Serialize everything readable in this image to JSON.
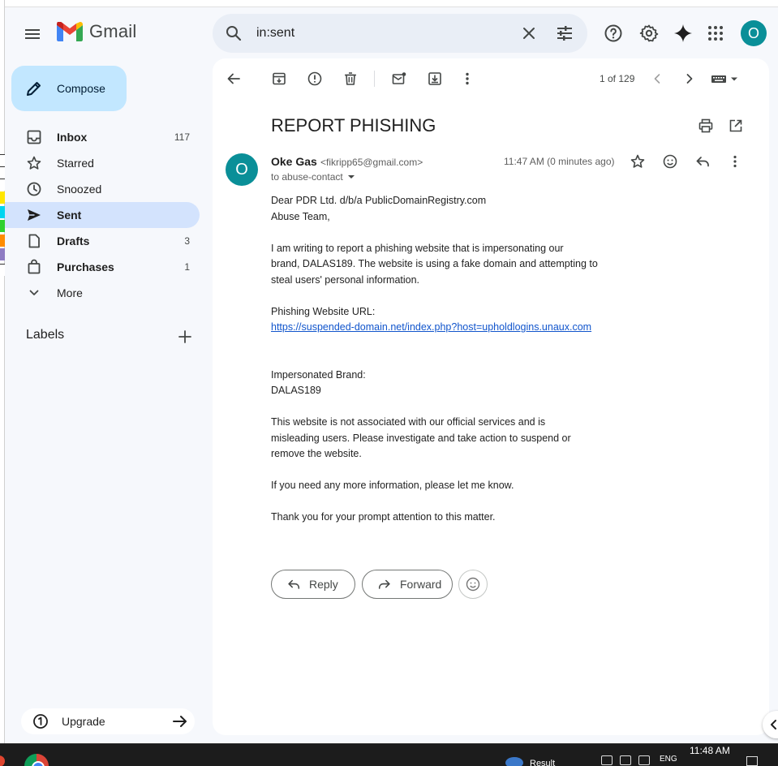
{
  "app": {
    "name": "Gmail",
    "avatar_letter": "O"
  },
  "search": {
    "value": "in:sent"
  },
  "compose": {
    "label": "Compose"
  },
  "nav": [
    {
      "label": "Inbox",
      "count": "117",
      "icon": "inbox-icon",
      "bold": true
    },
    {
      "label": "Starred",
      "count": "",
      "icon": "star-icon",
      "bold": false
    },
    {
      "label": "Snoozed",
      "count": "",
      "icon": "clock-icon",
      "bold": false
    },
    {
      "label": "Sent",
      "count": "",
      "icon": "send-icon",
      "bold": true,
      "active": true
    },
    {
      "label": "Drafts",
      "count": "3",
      "icon": "draft-icon",
      "bold": true
    },
    {
      "label": "Purchases",
      "count": "1",
      "icon": "shopping-bag-icon",
      "bold": true
    },
    {
      "label": "More",
      "count": "",
      "icon": "chevron-down-icon",
      "bold": false
    }
  ],
  "labels": {
    "title": "Labels"
  },
  "upgrade": {
    "label": "Upgrade"
  },
  "toolbar": {
    "pager": "1 of 129"
  },
  "email": {
    "subject": "REPORT PHISHING",
    "sender_name": "Oke Gas",
    "sender_email": "<fikripp65@gmail.com>",
    "to": "to abuse-contact",
    "time": "11:47 AM (0 minutes ago)",
    "avatar_letter": "O",
    "body": {
      "greeting1": "Dear PDR Ltd. d/b/a PublicDomainRegistry.com",
      "greeting2": "Abuse Team,",
      "p1a": "I am writing to report a phishing website that is impersonating our",
      "p1b": "brand, DALAS189. The website is using a fake domain and attempting to",
      "p1c": "steal users' personal information.",
      "url_label": "Phishing Website URL:",
      "url": "https://suspended-domain.net/index.php?host=upholdlogins.unaux.com",
      "brand_label": "Impersonated Brand:",
      "brand": "DALAS189",
      "p2a": "This website is not associated with our official services and is",
      "p2b": "misleading users. Please investigate and take action to suspend or",
      "p2c": "remove the website.",
      "p3": "If you need any more information, please let me know.",
      "p4": "Thank you for your prompt attention to this matter."
    },
    "reply_label": "Reply",
    "forward_label": "Forward"
  },
  "taskbar": {
    "clock": "11:48 AM",
    "lang": "ENG",
    "weather": "Result"
  },
  "colors": {
    "accent": "#0b57d0",
    "compose_bg": "#c2e7ff",
    "active_nav": "#d3e3fd",
    "avatar": "#0a8f98"
  }
}
